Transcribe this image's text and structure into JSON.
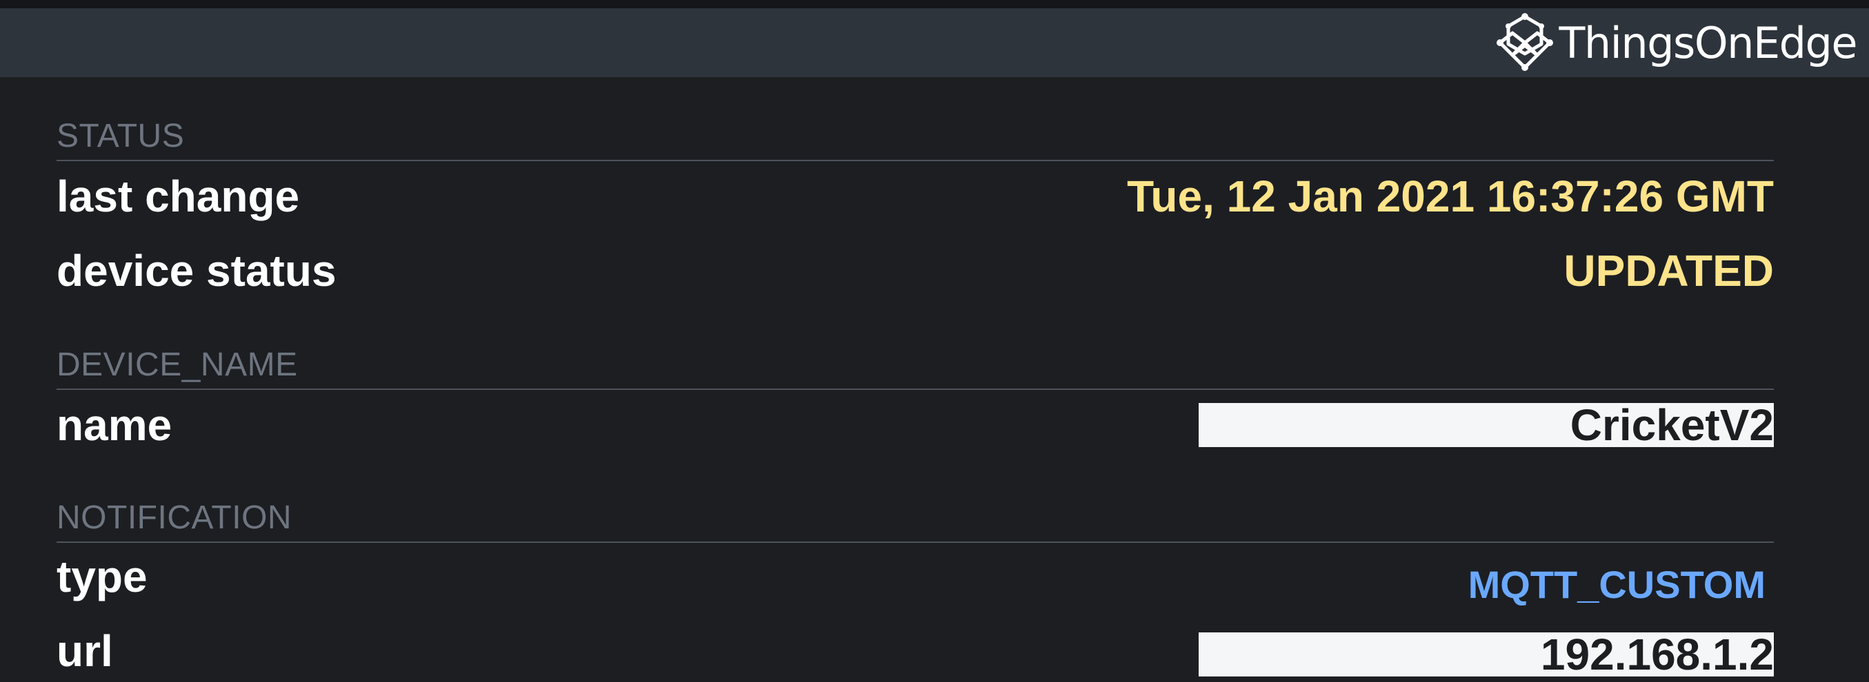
{
  "brand": {
    "name": "ThingsOnEdge",
    "logo_icon": "hexagon-network-icon"
  },
  "sections": {
    "status": {
      "title": "STATUS",
      "last_change_label": "last change",
      "last_change_value": "Tue, 12 Jan 2021 16:37:26 GMT",
      "device_status_label": "device status",
      "device_status_value": "UPDATED"
    },
    "device_name": {
      "title": "DEVICE_NAME",
      "name_label": "name",
      "name_value": "CricketV2"
    },
    "notification": {
      "title": "NOTIFICATION",
      "type_label": "type",
      "type_value": "MQTT_CUSTOM",
      "url_label": "url",
      "url_value": "192.168.1.2"
    }
  },
  "colors": {
    "background": "#1c1e22",
    "header": "#2e343c",
    "accent_yellow": "#fde38a",
    "accent_blue": "#6aa8ff",
    "section_title": "#6e7580",
    "field_background": "#f5f6f7"
  }
}
